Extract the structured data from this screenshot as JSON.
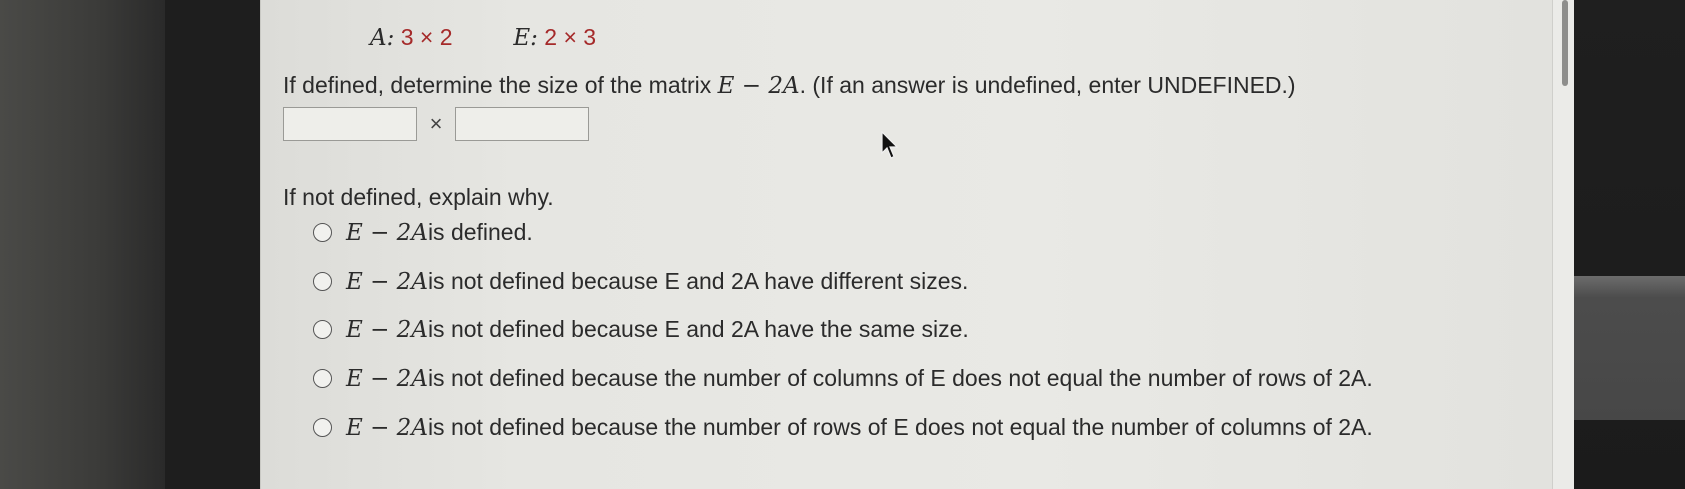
{
  "matrix_sizes": {
    "a_label": "A:",
    "a_size": "3 × 2",
    "e_label": "E:",
    "e_size": "2 × 3"
  },
  "question": {
    "prefix": "If defined, determine the size of the matrix ",
    "expression": "E − 2A",
    "suffix": ".  (If an answer is undefined, enter UNDEFINED.)"
  },
  "answer": {
    "rows_value": "",
    "times_symbol": "×",
    "cols_value": ""
  },
  "explain_prompt": "If not defined, explain why.",
  "options": [
    {
      "math": "E − 2A",
      "text": " is defined.",
      "selected": false
    },
    {
      "math": "E − 2A",
      "text": " is not defined because E and 2A have different sizes.",
      "selected": false
    },
    {
      "math": "E − 2A",
      "text": " is not defined because E and 2A have the same size.",
      "selected": false
    },
    {
      "math": "E − 2A",
      "text": " is not defined because the number of columns of E does not equal the number of rows of 2A.",
      "selected": false
    },
    {
      "math": "E − 2A",
      "text": " is not defined because the number of rows of E does not equal the number of columns of 2A.",
      "selected": false
    }
  ],
  "colors": {
    "accent": "#a52a2a",
    "text": "#2b2b2b",
    "page": "#e9e9e5"
  },
  "icons": [
    "mouse-pointer-icon"
  ]
}
